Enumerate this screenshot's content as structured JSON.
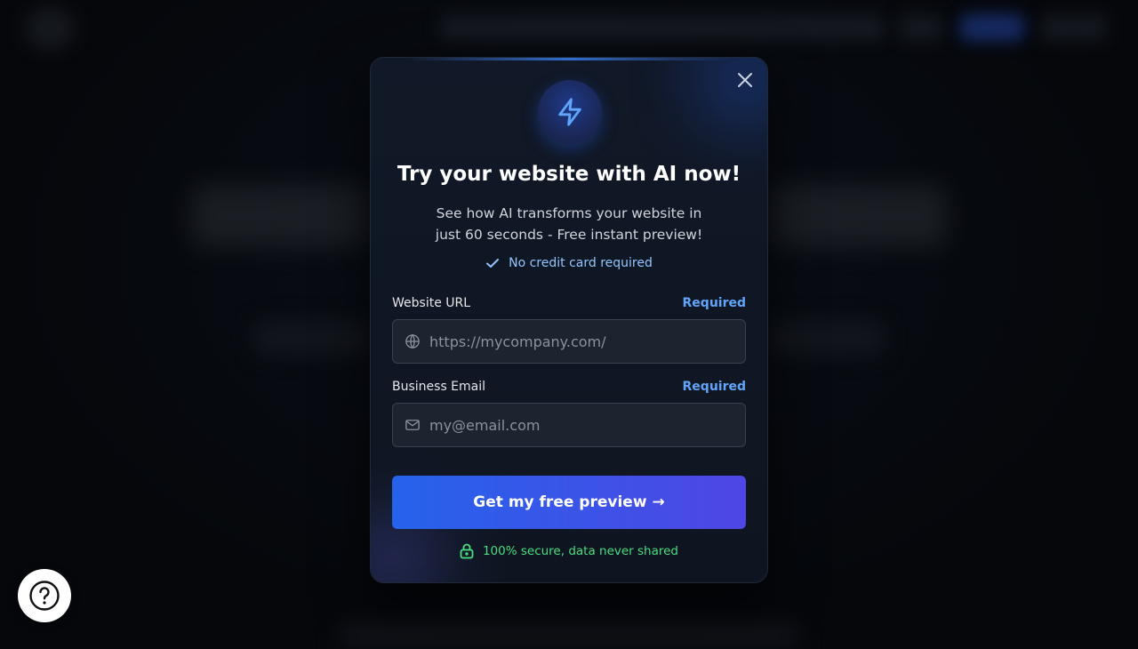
{
  "modal": {
    "title": "Try your website with AI now!",
    "subtitle": "See how AI transforms your website in just 60 seconds - Free instant preview!",
    "no_credit_card": "No credit card required",
    "fields": [
      {
        "label": "Website URL",
        "required": "Required",
        "placeholder": "https://mycompany.com/",
        "value": "",
        "icon": "globe-icon"
      },
      {
        "label": "Business Email",
        "required": "Required",
        "placeholder": "my@email.com",
        "value": "",
        "icon": "mail-icon"
      }
    ],
    "cta_label": "Get my free preview →",
    "secure_note": "100% secure, data never shared",
    "header_icon": "lightning-bolt-icon",
    "close_icon": "close-icon"
  },
  "help": {
    "icon": "help-circle-icon"
  },
  "colors": {
    "accent": "#3b82f6",
    "required": "#60a5fa",
    "secure": "#4ade80",
    "cta_start": "#2563eb",
    "cta_end": "#4f46e5"
  }
}
